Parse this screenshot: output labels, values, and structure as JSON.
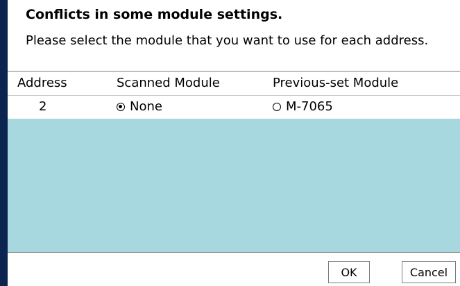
{
  "dialog": {
    "heading": "Conflicts in some module settings.",
    "instructions": "Please select the module that you want to use for each address."
  },
  "table": {
    "columns": {
      "address": "Address",
      "scanned": "Scanned Module",
      "previous": "Previous-set Module"
    },
    "rows": [
      {
        "address": "2",
        "scanned": "None",
        "scanned_selected": true,
        "previous": "M-7065",
        "previous_selected": false
      }
    ]
  },
  "buttons": {
    "ok": "OK",
    "cancel": "Cancel"
  },
  "colors": {
    "list_background": "#a8d8df",
    "dialog_background": "#ffffff"
  }
}
